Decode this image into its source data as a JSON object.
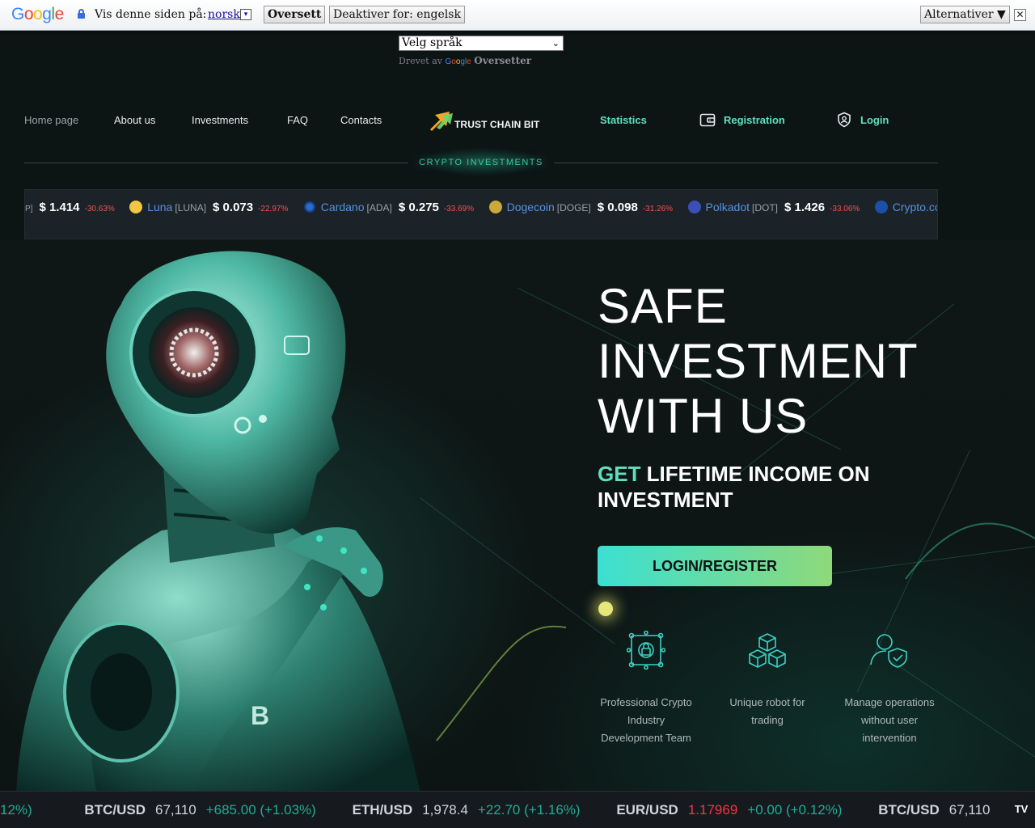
{
  "translate_bar": {
    "view_label": "Vis denne siden på:",
    "language": "norsk",
    "language_drop": "▾",
    "translate_button": "Oversett",
    "disable_button": "Deaktiver for: engelsk",
    "options_button": "Alternativer ▼",
    "close": "✕"
  },
  "language_selector": {
    "value": "Velg språk",
    "powered_by": "Drevet av",
    "brand": "Oversetter"
  },
  "nav": {
    "home": "Home page",
    "about": "About us",
    "investments": "Investments",
    "faq": "FAQ",
    "contacts": "Contacts",
    "logo_text": "TRUST CHAIN BIT",
    "statistics": "Statistics",
    "registration": "Registration",
    "login": "Login",
    "tagline": "CRYPTO INVESTMENTS"
  },
  "price_ticker": {
    "lead_symbol": "P]",
    "lead_price": "$ 1.414",
    "lead_change": "-30.63%",
    "items": [
      {
        "name": "Luna",
        "symbol": "[LUNA]",
        "price": "$ 0.073",
        "change": "-22.97%",
        "color": "#f4c542"
      },
      {
        "name": "Cardano",
        "symbol": "[ADA]",
        "price": "$ 0.275",
        "change": "-33.69%",
        "color": "#2a6bd1"
      },
      {
        "name": "Dogecoin",
        "symbol": "[DOGE]",
        "price": "$ 0.098",
        "change": "-31.26%",
        "color": "#c9a93b"
      },
      {
        "name": "Polkadot",
        "symbol": "[DOT]",
        "price": "$ 1.426",
        "change": "-33.06%",
        "color": "#3b4fb8"
      },
      {
        "name": "Crypto.com",
        "symbol": "",
        "price": "",
        "change": "",
        "color": "#1e4fa8"
      }
    ]
  },
  "hero": {
    "title_line1": "SAFE",
    "title_line2": "INVESTMENT",
    "title_line3": "WITH US",
    "sub_accent": "GET",
    "sub_rest": " LIFETIME INCOME ON INVESTMENT",
    "cta": "LOGIN/REGISTER"
  },
  "features": [
    {
      "icon": "circuit-lock-icon",
      "lines": [
        "Professional Crypto",
        "Industry",
        "Development Team"
      ]
    },
    {
      "icon": "cubes-icon",
      "lines": [
        "Unique robot for",
        "trading"
      ]
    },
    {
      "icon": "user-shield-icon",
      "lines": [
        "Manage operations",
        "without user",
        "intervention"
      ]
    }
  ],
  "tv_ticker": {
    "lead": "12%)",
    "items": [
      {
        "pair": "BTC/USD",
        "price": "67,110",
        "change": "+685.00 (+1.03%)",
        "red": false
      },
      {
        "pair": "ETH/USD",
        "price": "1,978.4",
        "change": "+22.70 (+1.16%)",
        "red": false
      },
      {
        "pair": "EUR/USD",
        "price": "1.17969",
        "change": "+0.00 (+0.12%)",
        "red": true
      },
      {
        "pair": "BTC/USD",
        "price": "67,110",
        "change": "",
        "red": false
      }
    ],
    "logo": "TV"
  },
  "colors": {
    "accent": "#5fe0bd",
    "background": "#0d1414",
    "negative": "#ef5350",
    "positive": "#22ab94"
  }
}
